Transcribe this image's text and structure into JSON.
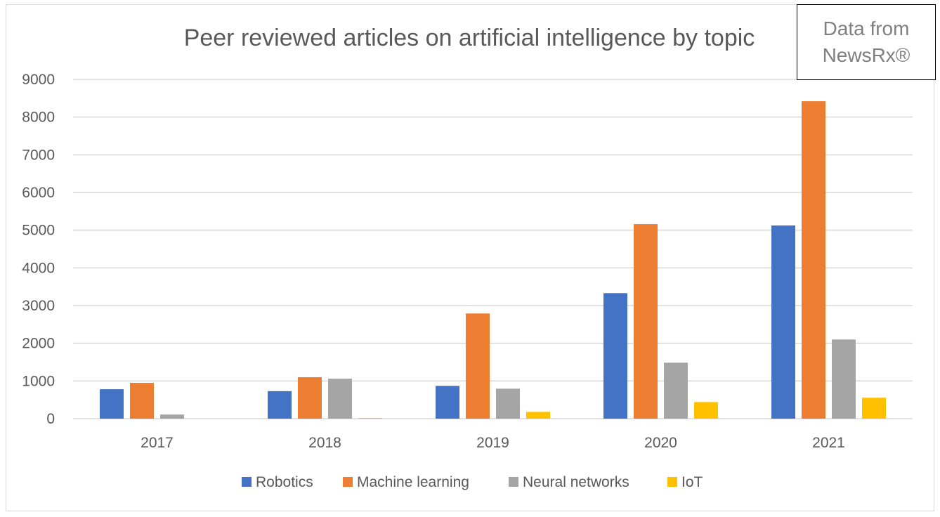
{
  "chart_data": {
    "type": "bar",
    "title": "Peer reviewed articles on artificial intelligence by topic",
    "xlabel": "",
    "ylabel": "",
    "categories": [
      "2017",
      "2018",
      "2019",
      "2020",
      "2021"
    ],
    "ylim": [
      0,
      9000
    ],
    "yticks": [
      0,
      1000,
      2000,
      3000,
      4000,
      5000,
      6000,
      7000,
      8000,
      9000
    ],
    "grid": true,
    "legend_position": "bottom",
    "series": [
      {
        "name": "Robotics",
        "color": "#4472c4",
        "values": [
          780,
          730,
          870,
          3330,
          5125
        ]
      },
      {
        "name": "Machine learning",
        "color": "#ed7d31",
        "values": [
          950,
          1100,
          2790,
          5160,
          8420
        ]
      },
      {
        "name": "Neural networks",
        "color": "#a5a5a5",
        "values": [
          110,
          1060,
          795,
          1485,
          2100
        ]
      },
      {
        "name": "IoT",
        "color": "#ffc000",
        "values": [
          0,
          20,
          180,
          440,
          555
        ]
      }
    ],
    "annotations": [
      "Data from",
      "NewsRx®"
    ]
  },
  "source_box": {
    "line1": "Data from",
    "line2": "NewsRx®"
  }
}
